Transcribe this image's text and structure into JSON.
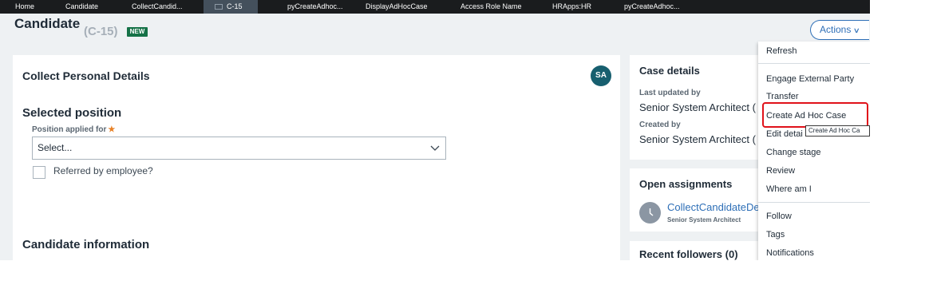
{
  "tabs": [
    {
      "label": "Home",
      "active": false
    },
    {
      "label": "Candidate",
      "active": false
    },
    {
      "label": "CollectCandid...",
      "active": false
    },
    {
      "label": "C-15",
      "active": true
    },
    {
      "label": "pyCreateAdhoc...",
      "active": false
    },
    {
      "label": "DisplayAdHocCase",
      "active": false
    },
    {
      "label": "Access Role Name",
      "active": false
    },
    {
      "label": "HRApps:HR",
      "active": false
    },
    {
      "label": "pyCreateAdhoc...",
      "active": false
    }
  ],
  "header": {
    "case_type": "Candidate",
    "case_id": "(C-15)",
    "status": "NEW",
    "actions_label": "Actions"
  },
  "main": {
    "step_title": "Collect Personal Details",
    "avatar_initials": "SA",
    "section_position": "Selected position",
    "position_label": "Position applied for",
    "required_marker": "★",
    "position_value": "Select...",
    "referred_label": "Referred by employee?",
    "section_candidate": "Candidate information"
  },
  "case_details": {
    "title": "Case details",
    "last_updated_label": "Last updated by",
    "last_updated_value": "Senior System Architect (",
    "created_label": "Created by",
    "created_value": "Senior System Architect ("
  },
  "assignments": {
    "title": "Open assignments",
    "link": "CollectCandidateDe",
    "assignee": "Senior System Architect"
  },
  "followers": {
    "title": "Recent followers (0)"
  },
  "menu": {
    "items": [
      "Refresh",
      "Engage External Party",
      "Transfer",
      "Create Ad Hoc Case",
      "Edit detai",
      "Change stage",
      "Review",
      "Where am I",
      "Follow",
      "Tags",
      "Notifications"
    ],
    "tooltip": "Create Ad Hoc Ca"
  },
  "colors": {
    "tabbar": "#1a1c1e",
    "accent": "#2e6fb7",
    "badge": "#157247",
    "avatar": "#175f6f",
    "highlight": "#e0121a",
    "required": "#e88025"
  }
}
